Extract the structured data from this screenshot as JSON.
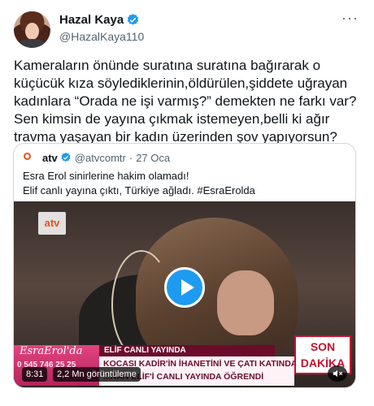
{
  "author": {
    "name": "Hazal Kaya",
    "handle": "@HazalKaya110",
    "verified": true
  },
  "tweet": {
    "text": "Kameraların önünde suratına suratına bağırarak o küçücük kıza söylediklerinin,öldürülen,şiddete uğrayan kadınlara “Orada ne işi varmış?” demekten ne farkı var?Sen kimsin de yayına çıkmak istemeyen,belli ki ağır travma yaşayan bir kadın üzerinden şov yapıyorsun?",
    "more_icon": "more-options-icon"
  },
  "quoted": {
    "name": "atv",
    "handle": "@atvcomtr",
    "separator": "·",
    "date": "27 Oca",
    "verified": true,
    "text_line1": "Esra Erol sinirlerine hakim olamadı!",
    "text_line2": "Elif canlı yayına çıktı, Türkiye ağladı. #EsraErolda"
  },
  "video": {
    "channel_logo": "atv",
    "lower_third": {
      "show_logo": "EsraErol'da",
      "phone": "0 545 746 25 25",
      "tag": "ELİF CANLI YAYINDA",
      "line1": "KOCASI KADİR'İN İHANETİNİ VE ÇATI KATINDA",
      "line2": "...NAN ELİF'İ CANLI YAYINDA ÖĞRENDİ",
      "son": "SON",
      "dakika": "DAKİKA"
    },
    "duration": "8:31",
    "views": "2,2 Mn görüntüleme"
  },
  "colors": {
    "verified": "#1d9bf0",
    "play": "#1d9bf0",
    "atv_orange": "#e8501c",
    "banner_pink": "#e3447f",
    "banner_dark": "#6b0c2b",
    "son_dakika_red": "#c8102e"
  }
}
